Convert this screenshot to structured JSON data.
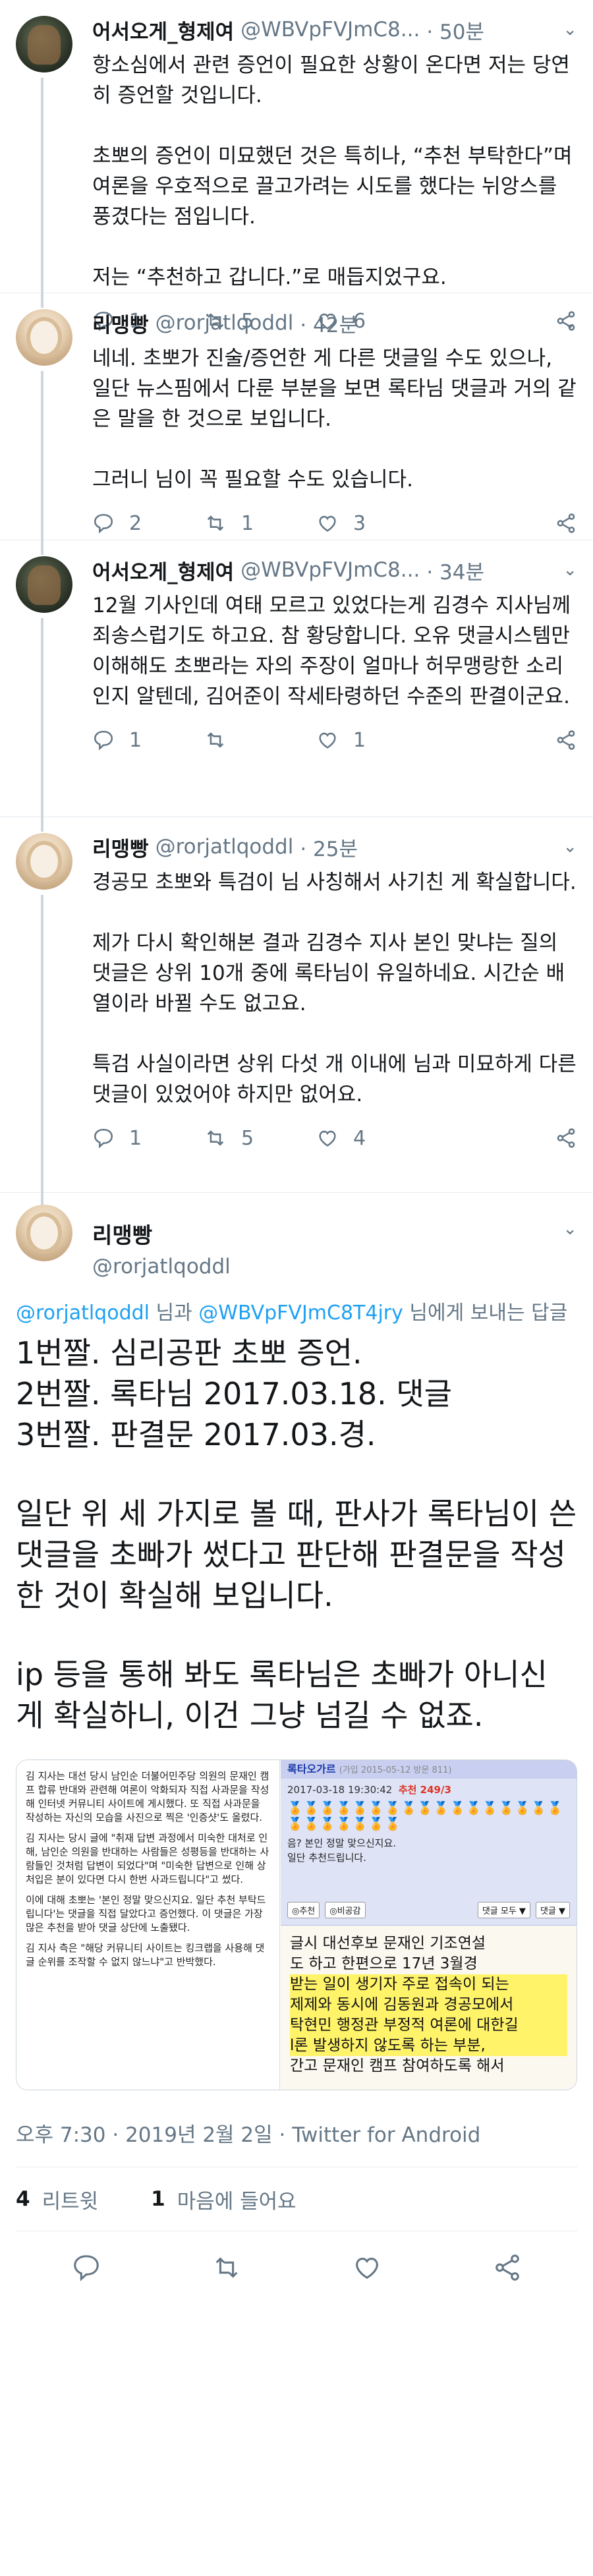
{
  "tweets": [
    {
      "name": "어서오게_형제여",
      "handle": "@WBVpFVJmC8...",
      "time": "· 50분",
      "text": "항소심에서 관련 증언이 필요한 상황이 온다면 저는 당연히 증언할 것입니다.\n\n초뽀의 증언이 미묘했던 것은 특히나, “추천 부탁한다”며 여론을 우호적으로 끌고가려는 시도를 했다는 뉘앙스를 풍겼다는 점입니다.\n\n저는 “추천하고 갑니다.”로 매듭지었구요.",
      "replies": "1",
      "retweets": "5",
      "likes": "6"
    },
    {
      "name": "리맹빵",
      "handle": "@rorjatlqoddl",
      "time": "· 42분",
      "text": "네네. 초뽀가 진술/증언한 게 다른 댓글일 수도 있으나, 일단 뉴스핌에서 다룬 부분을 보면 록타님 댓글과 거의 같은 말을 한 것으로 보입니다.\n\n그러니 님이 꼭 필요할 수도 있습니다.",
      "replies": "2",
      "retweets": "1",
      "likes": "3"
    },
    {
      "name": "어서오게_형제여",
      "handle": "@WBVpFVJmC8...",
      "time": "· 34분",
      "text": "12월 기사인데 여태 모르고 있었다는게 김경수 지사님께 죄송스럽기도 하고요. 참 황당합니다. 오유 댓글시스템만 이해해도 초뽀라는 자의 주장이 얼마나 허무맹랑한 소리인지 알텐데, 김어준이 작세타령하던 수준의 판결이군요.",
      "replies": "1",
      "retweets": "",
      "likes": "1"
    },
    {
      "name": "리맹빵",
      "handle": "@rorjatlqoddl",
      "time": "· 25분",
      "text": "경공모 초뽀와 특검이 님 사칭해서 사기친 게 확실합니다.\n\n제가 다시 확인해본 결과 김경수 지사 본인 맞냐는 질의 댓글은 상위 10개 중에 록타님이 유일하네요. 시간순 배열이라 바뀔 수도 없고요.\n\n특검 사실이라면 상위 다섯 개 이내에 님과 미묘하게 다른 댓글이 있었어야 하지만 없어요.",
      "replies": "1",
      "retweets": "5",
      "likes": "4"
    }
  ],
  "main": {
    "name": "리맹빵",
    "handle": "@rorjatlqoddl",
    "replying": {
      "handle1": "@rorjatlqoddl",
      "sep": " 님과 ",
      "handle2": "@WBVpFVJmC8T4jry",
      "suffix": " 님에게 보내는 답글"
    },
    "list": "1번짤. 심리공판 초뽀 증언.\n2번짤. 록타님 2017.03.18. 댓글\n3번짤. 판결문 2017.03.경.",
    "para1": "일단 위 세 가지로 볼 때, 판사가 록타님이 쓴 댓글을 초빠가 썼다고 판단해 판결문을 작성한 것이 확실해 보입니다.",
    "para2": "ip 등을 통해 봐도 록타님은 초빠가 아니신 게 확실하니, 이건 그냥 넘길 수 없죠.",
    "attachment": {
      "doc_p1": "김 지사는 대선 당시 남인순 더불어민주당 의원의 문재인 캠프 합류 반대와 관련해 여론이 악화되자 직접 사과문을 작성해 인터넷 커뮤니티 사이트에 게시했다. 또 직접 사과문을 작성하는 자신의 모습을 사진으로 찍은 '인증샷'도 올렸다.",
      "doc_p2": "김 지사는 당시 글에 \"취재 답변 과정에서 미숙한 대처로 인해, 남인순 의원을 반대하는 사람들은 성평등을 반대하는 사람들인 것처럼 답변이 되었다\"며 \"미숙한 답변으로 인해 상처입은 분이 있다면 다시 한번 사과드립니다\"고 썼다.",
      "doc_p3": "이에 대해 초뽀는 '본인 정말 맞으신지요. 일단 추천 부탁드립니다'는 댓글을 직접 달았다고 증언했다. 이 댓글은 가장 많은 추천을 받아 댓글 상단에 노출됐다.",
      "doc_p4": "김 지사 측은 \"해당 커뮤니티 사이트는 킹크랩을 사용해 댓글 순위를 조작할 수 없지 않느냐\"고 반박했다.",
      "shot_title": "록타오가르",
      "shot_sub": "(가입 2015-05-12 방문 811)",
      "shot_date": "2017-03-18 19:30:42",
      "shot_rec": "추천 249/3",
      "medals": "🏅🏅🏅🏅🏅🏅🏅🏅🏅🏅🏅🏅🏅🏅🏅🏅🏅🏅🏅🏅🏅🏅🏅🏅",
      "shot_c1": "음? 본인 정말 맞으신지요.",
      "shot_c2": "일단 추천드립니다.",
      "shot_b1": "◎추천",
      "shot_b2": "◎비공감",
      "shot_b3": "댓글 모두 ▼",
      "shot_b4": "댓글 ▼",
      "news_l1": "글시 대선후보 문재인 기조연설",
      "news_l2": "도 하고 한편으로 17년 3월경",
      "news_l3": "받는 일이 생기자 주로 접속이 되는",
      "news_l4": "제제와 동시에 김동원과 경공모에서",
      "news_l5": "탁현민 행정관 부정적 여론에 대한길",
      "news_l6": "l론 발생하지 않도록 하는 부분,",
      "news_l7": "간고 문재인 캠프 참여하도록 해서"
    },
    "meta": "오후 7:30 · 2019년 2월 2일 · Twitter for Android",
    "retweets_count": "4",
    "retweets_label": "리트윗",
    "likes_count": "1",
    "likes_label": "마음에 들어요"
  },
  "icons": [
    "reply-icon",
    "retweet-icon",
    "heart-icon",
    "share-icon",
    "chevron-down-icon"
  ],
  "colors": {
    "link": "#1da1f2",
    "secondary": "#657786",
    "text": "#14171a",
    "border": "#e6ecf0"
  }
}
